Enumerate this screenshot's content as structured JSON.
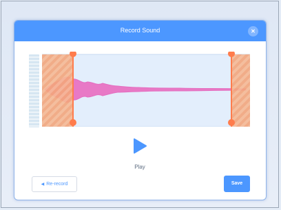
{
  "dialog": {
    "title": "Record Sound",
    "close_icon": "close-icon"
  },
  "playback": {
    "play_label": "Play",
    "play_icon": "play-icon"
  },
  "actions": {
    "rerecord_label": "Re-record",
    "rerecord_icon": "undo-arrow-icon",
    "save_label": "Save"
  },
  "trim": {
    "start_fraction": 0.15,
    "end_fraction": 0.91
  },
  "colors": {
    "accent": "#4c97ff",
    "waveform": "#e879c6",
    "trim_handle": "#ff7c4c",
    "trimmed_region": "#f2a37a"
  }
}
